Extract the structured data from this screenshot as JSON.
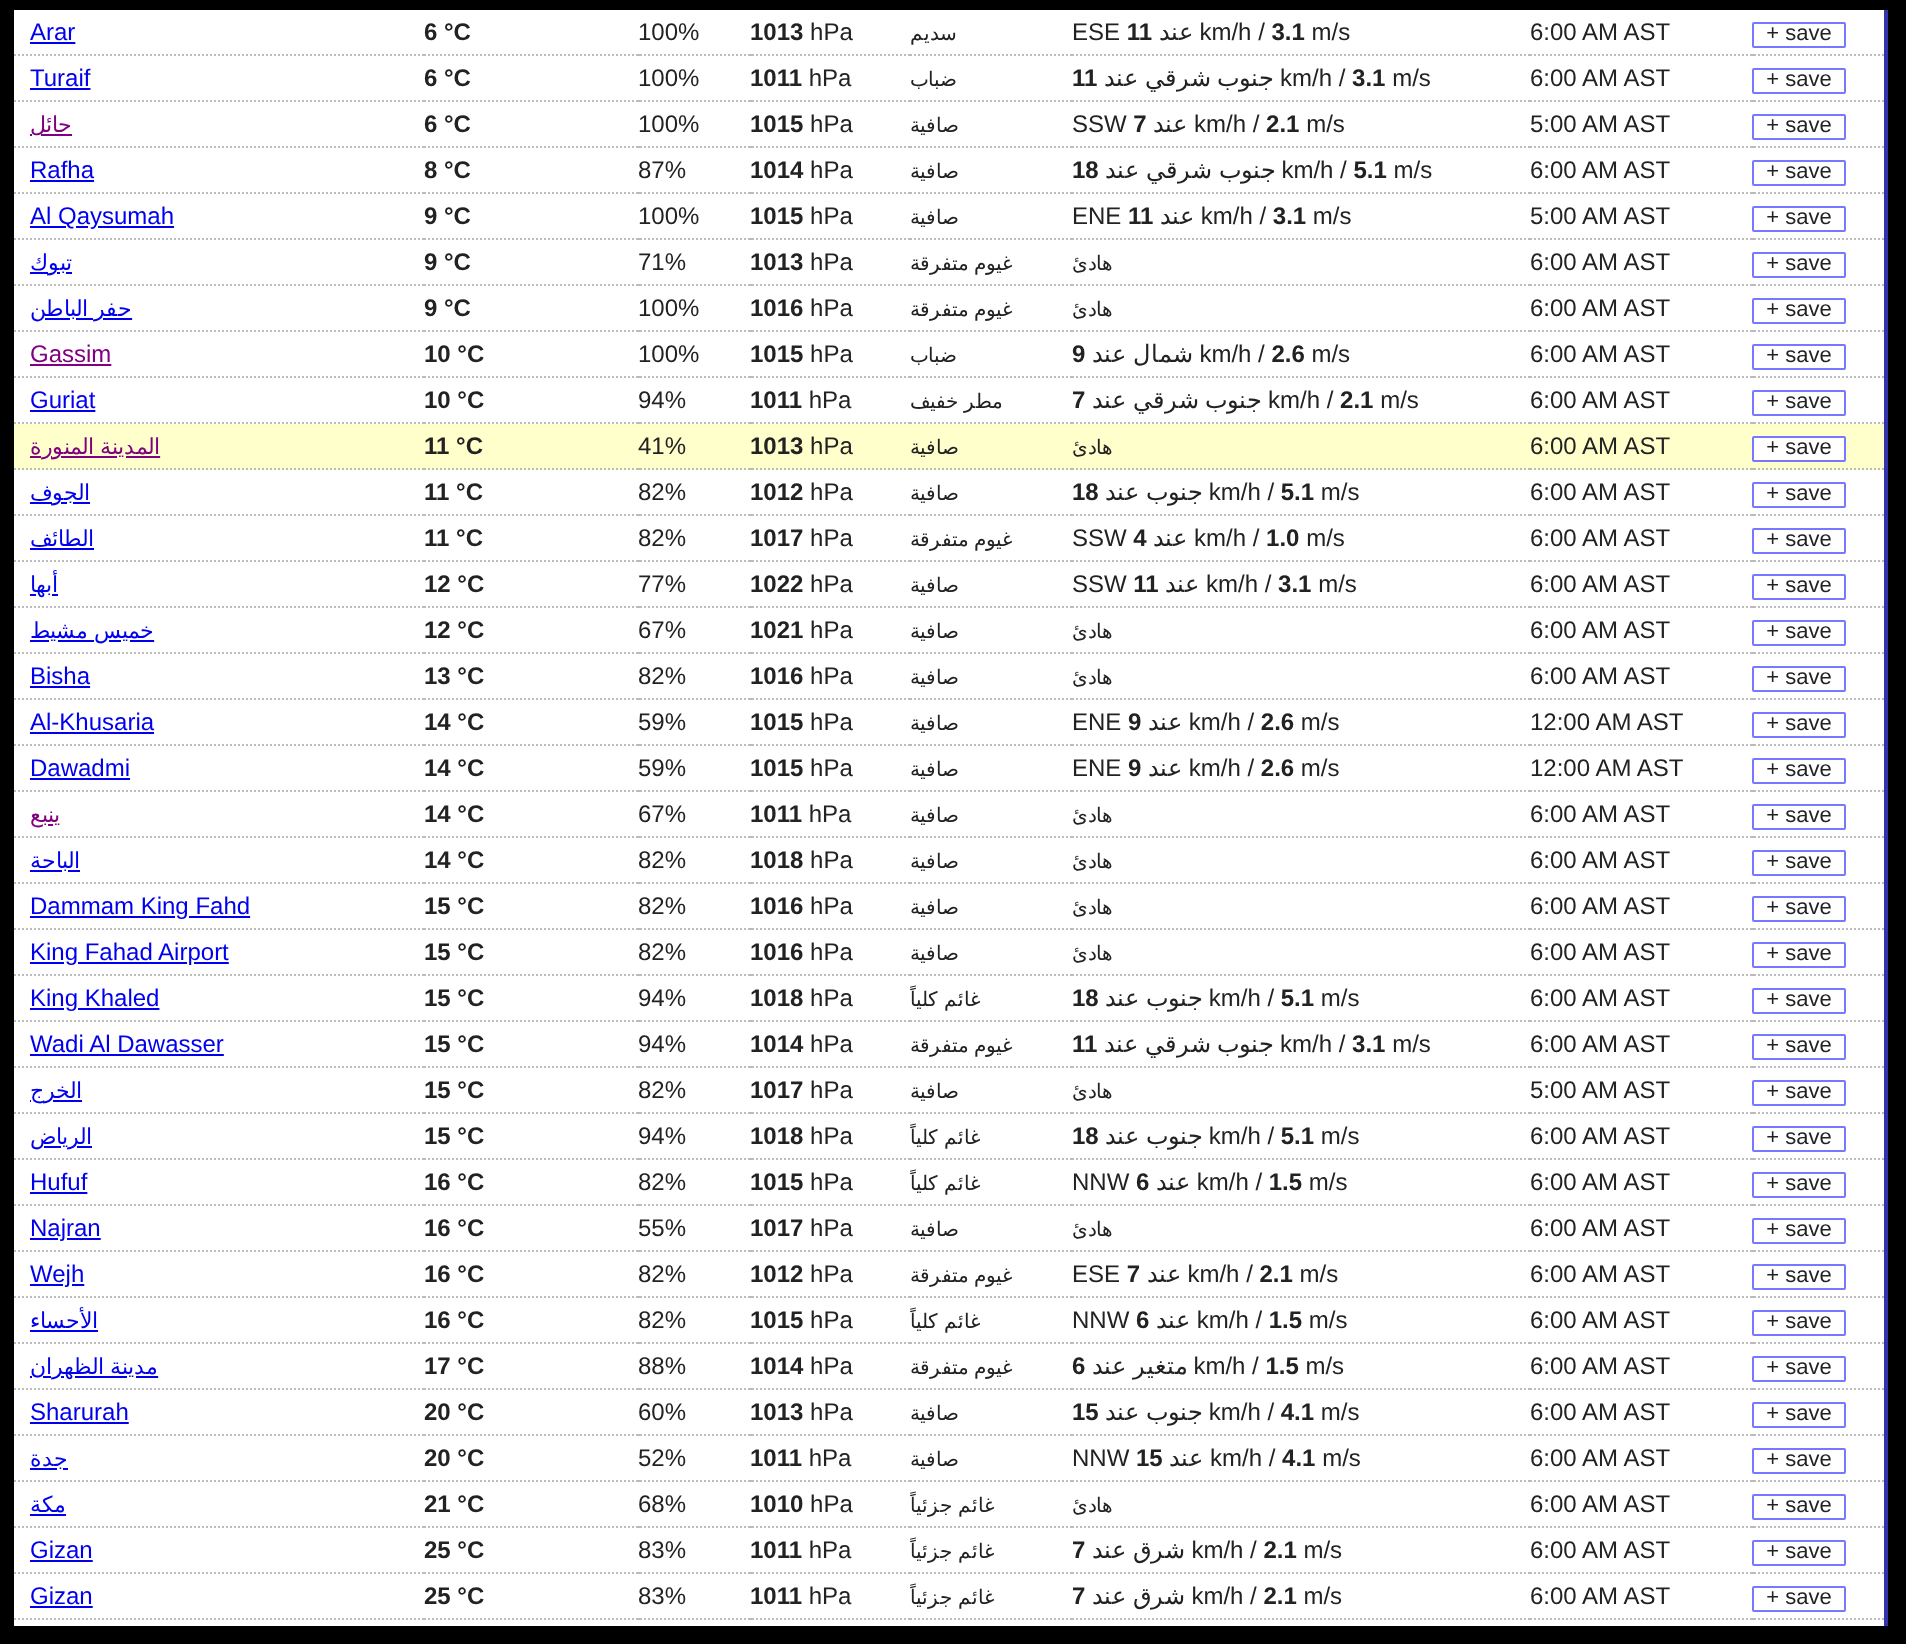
{
  "rows": [
    {
      "city": "Arar",
      "visited": false,
      "highlighted": false,
      "temperature": "6 °C",
      "humidity": "100%",
      "pressure": "**1013** hPa",
      "condition": "سديم",
      "wind": "ESE عند **11** km/h / **3.1** m/s",
      "time": "6:00 AM AST",
      "button": "+ save"
    },
    {
      "city": "Turaif",
      "visited": false,
      "highlighted": false,
      "temperature": "6 °C",
      "humidity": "100%",
      "pressure": "**1011** hPa",
      "condition": "ضباب",
      "wind": "جنوب شرقي عند **11** km/h / **3.1** m/s",
      "time": "6:00 AM AST",
      "button": "+ save"
    },
    {
      "city": "حائل",
      "visited": true,
      "highlighted": false,
      "temperature": "6 °C",
      "humidity": "100%",
      "pressure": "**1015** hPa",
      "condition": "صافية",
      "wind": "SSW عند **7** km/h / **2.1** m/s",
      "time": "5:00 AM AST",
      "button": "+ save"
    },
    {
      "city": "Rafha",
      "visited": false,
      "highlighted": false,
      "temperature": "8 °C",
      "humidity": "87%",
      "pressure": "**1014** hPa",
      "condition": "صافية",
      "wind": "جنوب شرقي عند **18** km/h / **5.1** m/s",
      "time": "6:00 AM AST",
      "button": "+ save"
    },
    {
      "city": "Al Qaysumah",
      "visited": false,
      "highlighted": false,
      "temperature": "9 °C",
      "humidity": "100%",
      "pressure": "**1015** hPa",
      "condition": "صافية",
      "wind": "ENE عند **11** km/h / **3.1** m/s",
      "time": "5:00 AM AST",
      "button": "+ save"
    },
    {
      "city": "تبوك",
      "visited": false,
      "highlighted": false,
      "temperature": "9 °C",
      "humidity": "71%",
      "pressure": "**1013** hPa",
      "condition": "غيوم متفرقة",
      "wind": "هادئ",
      "time": "6:00 AM AST",
      "button": "+ save"
    },
    {
      "city": "حفر الباطن",
      "visited": false,
      "highlighted": false,
      "temperature": "9 °C",
      "humidity": "100%",
      "pressure": "**1016** hPa",
      "condition": "غيوم متفرقة",
      "wind": "هادئ",
      "time": "6:00 AM AST",
      "button": "+ save"
    },
    {
      "city": "Gassim",
      "visited": true,
      "highlighted": false,
      "temperature": "10 °C",
      "humidity": "100%",
      "pressure": "**1015** hPa",
      "condition": "ضباب",
      "wind": "شمال عند **9** km/h / **2.6** m/s",
      "time": "6:00 AM AST",
      "button": "+ save"
    },
    {
      "city": "Guriat",
      "visited": false,
      "highlighted": false,
      "temperature": "10 °C",
      "humidity": "94%",
      "pressure": "**1011** hPa",
      "condition": "مطر خفيف",
      "wind": "جنوب شرقي عند **7** km/h / **2.1** m/s",
      "time": "6:00 AM AST",
      "button": "+ save"
    },
    {
      "city": "المدينة المنورة",
      "visited": true,
      "highlighted": true,
      "temperature": "11 °C",
      "humidity": "41%",
      "pressure": "**1013** hPa",
      "condition": "صافية",
      "wind": "هادئ",
      "time": "6:00 AM AST",
      "button": "+ save"
    },
    {
      "city": "الجوف",
      "visited": false,
      "highlighted": false,
      "temperature": "11 °C",
      "humidity": "82%",
      "pressure": "**1012** hPa",
      "condition": "صافية",
      "wind": "جنوب عند **18** km/h / **5.1** m/s",
      "time": "6:00 AM AST",
      "button": "+ save"
    },
    {
      "city": "الطائف",
      "visited": false,
      "highlighted": false,
      "temperature": "11 °C",
      "humidity": "82%",
      "pressure": "**1017** hPa",
      "condition": "غيوم متفرقة",
      "wind": "SSW عند **4** km/h / **1.0** m/s",
      "time": "6:00 AM AST",
      "button": "+ save"
    },
    {
      "city": "أبها",
      "visited": false,
      "highlighted": false,
      "temperature": "12 °C",
      "humidity": "77%",
      "pressure": "**1022** hPa",
      "condition": "صافية",
      "wind": "SSW عند **11** km/h / **3.1** m/s",
      "time": "6:00 AM AST",
      "button": "+ save"
    },
    {
      "city": "خميس مشيط",
      "visited": false,
      "highlighted": false,
      "temperature": "12 °C",
      "humidity": "67%",
      "pressure": "**1021** hPa",
      "condition": "صافية",
      "wind": "هادئ",
      "time": "6:00 AM AST",
      "button": "+ save"
    },
    {
      "city": "Bisha",
      "visited": false,
      "highlighted": false,
      "temperature": "13 °C",
      "humidity": "82%",
      "pressure": "**1016** hPa",
      "condition": "صافية",
      "wind": "هادئ",
      "time": "6:00 AM AST",
      "button": "+ save"
    },
    {
      "city": "Al-Khusaria",
      "visited": false,
      "highlighted": false,
      "temperature": "14 °C",
      "humidity": "59%",
      "pressure": "**1015** hPa",
      "condition": "صافية",
      "wind": "ENE عند **9** km/h / **2.6** m/s",
      "time": "12:00 AM AST",
      "button": "+ save"
    },
    {
      "city": "Dawadmi",
      "visited": false,
      "highlighted": false,
      "temperature": "14 °C",
      "humidity": "59%",
      "pressure": "**1015** hPa",
      "condition": "صافية",
      "wind": "ENE عند **9** km/h / **2.6** m/s",
      "time": "12:00 AM AST",
      "button": "+ save"
    },
    {
      "city": "ينبع",
      "visited": true,
      "highlighted": false,
      "temperature": "14 °C",
      "humidity": "67%",
      "pressure": "**1011** hPa",
      "condition": "صافية",
      "wind": "هادئ",
      "time": "6:00 AM AST",
      "button": "+ save"
    },
    {
      "city": "الباحة",
      "visited": false,
      "highlighted": false,
      "temperature": "14 °C",
      "humidity": "82%",
      "pressure": "**1018** hPa",
      "condition": "صافية",
      "wind": "هادئ",
      "time": "6:00 AM AST",
      "button": "+ save"
    },
    {
      "city": "Dammam King Fahd",
      "visited": false,
      "highlighted": false,
      "temperature": "15 °C",
      "humidity": "82%",
      "pressure": "**1016** hPa",
      "condition": "صافية",
      "wind": "هادئ",
      "time": "6:00 AM AST",
      "button": "+ save"
    },
    {
      "city": "King Fahad Airport",
      "visited": false,
      "highlighted": false,
      "temperature": "15 °C",
      "humidity": "82%",
      "pressure": "**1016** hPa",
      "condition": "صافية",
      "wind": "هادئ",
      "time": "6:00 AM AST",
      "button": "+ save"
    },
    {
      "city": "King Khaled",
      "visited": false,
      "highlighted": false,
      "temperature": "15 °C",
      "humidity": "94%",
      "pressure": "**1018** hPa",
      "condition": "غائم كلياً",
      "wind": "جنوب عند **18** km/h / **5.1** m/s",
      "time": "6:00 AM AST",
      "button": "+ save"
    },
    {
      "city": "Wadi Al Dawasser",
      "visited": false,
      "highlighted": false,
      "temperature": "15 °C",
      "humidity": "94%",
      "pressure": "**1014** hPa",
      "condition": "غيوم متفرقة",
      "wind": "جنوب شرقي عند **11** km/h / **3.1** m/s",
      "time": "6:00 AM AST",
      "button": "+ save"
    },
    {
      "city": "الخرج",
      "visited": false,
      "highlighted": false,
      "temperature": "15 °C",
      "humidity": "82%",
      "pressure": "**1017** hPa",
      "condition": "صافية",
      "wind": "هادئ",
      "time": "5:00 AM AST",
      "button": "+ save"
    },
    {
      "city": "الرياض",
      "visited": false,
      "highlighted": false,
      "temperature": "15 °C",
      "humidity": "94%",
      "pressure": "**1018** hPa",
      "condition": "غائم كلياً",
      "wind": "جنوب عند **18** km/h / **5.1** m/s",
      "time": "6:00 AM AST",
      "button": "+ save"
    },
    {
      "city": "Hufuf",
      "visited": false,
      "highlighted": false,
      "temperature": "16 °C",
      "humidity": "82%",
      "pressure": "**1015** hPa",
      "condition": "غائم كلياً",
      "wind": "NNW عند **6** km/h / **1.5** m/s",
      "time": "6:00 AM AST",
      "button": "+ save"
    },
    {
      "city": "Najran",
      "visited": false,
      "highlighted": false,
      "temperature": "16 °C",
      "humidity": "55%",
      "pressure": "**1017** hPa",
      "condition": "صافية",
      "wind": "هادئ",
      "time": "6:00 AM AST",
      "button": "+ save"
    },
    {
      "city": "Wejh",
      "visited": false,
      "highlighted": false,
      "temperature": "16 °C",
      "humidity": "82%",
      "pressure": "**1012** hPa",
      "condition": "غيوم متفرقة",
      "wind": "ESE عند **7** km/h / **2.1** m/s",
      "time": "6:00 AM AST",
      "button": "+ save"
    },
    {
      "city": "الأحساء",
      "visited": false,
      "highlighted": false,
      "temperature": "16 °C",
      "humidity": "82%",
      "pressure": "**1015** hPa",
      "condition": "غائم كلياً",
      "wind": "NNW عند **6** km/h / **1.5** m/s",
      "time": "6:00 AM AST",
      "button": "+ save"
    },
    {
      "city": "مدينة الظهران",
      "visited": false,
      "highlighted": false,
      "temperature": "17 °C",
      "humidity": "88%",
      "pressure": "**1014** hPa",
      "condition": "غيوم متفرقة",
      "wind": "متغير عند **6** km/h / **1.5** m/s",
      "time": "6:00 AM AST",
      "button": "+ save"
    },
    {
      "city": "Sharurah",
      "visited": false,
      "highlighted": false,
      "temperature": "20 °C",
      "humidity": "60%",
      "pressure": "**1013** hPa",
      "condition": "صافية",
      "wind": "جنوب عند **15** km/h / **4.1** m/s",
      "time": "6:00 AM AST",
      "button": "+ save"
    },
    {
      "city": "جدة",
      "visited": false,
      "highlighted": false,
      "temperature": "20 °C",
      "humidity": "52%",
      "pressure": "**1011** hPa",
      "condition": "صافية",
      "wind": "NNW عند **15** km/h / **4.1** m/s",
      "time": "6:00 AM AST",
      "button": "+ save"
    },
    {
      "city": "مكة",
      "visited": false,
      "highlighted": false,
      "temperature": "21 °C",
      "humidity": "68%",
      "pressure": "**1010** hPa",
      "condition": "غائم جزئياً",
      "wind": "هادئ",
      "time": "6:00 AM AST",
      "button": "+ save"
    },
    {
      "city": "Gizan",
      "visited": false,
      "highlighted": false,
      "temperature": "25 °C",
      "humidity": "83%",
      "pressure": "**1011** hPa",
      "condition": "غائم جزئياً",
      "wind": "شرق عند **7** km/h / **2.1** m/s",
      "time": "6:00 AM AST",
      "button": "+ save"
    },
    {
      "city": "Gizan",
      "visited": false,
      "highlighted": false,
      "temperature": "25 °C",
      "humidity": "83%",
      "pressure": "**1011** hPa",
      "condition": "غائم جزئياً",
      "wind": "شرق عند **7** km/h / **2.1** m/s",
      "time": "6:00 AM AST",
      "button": "+ save"
    }
  ]
}
